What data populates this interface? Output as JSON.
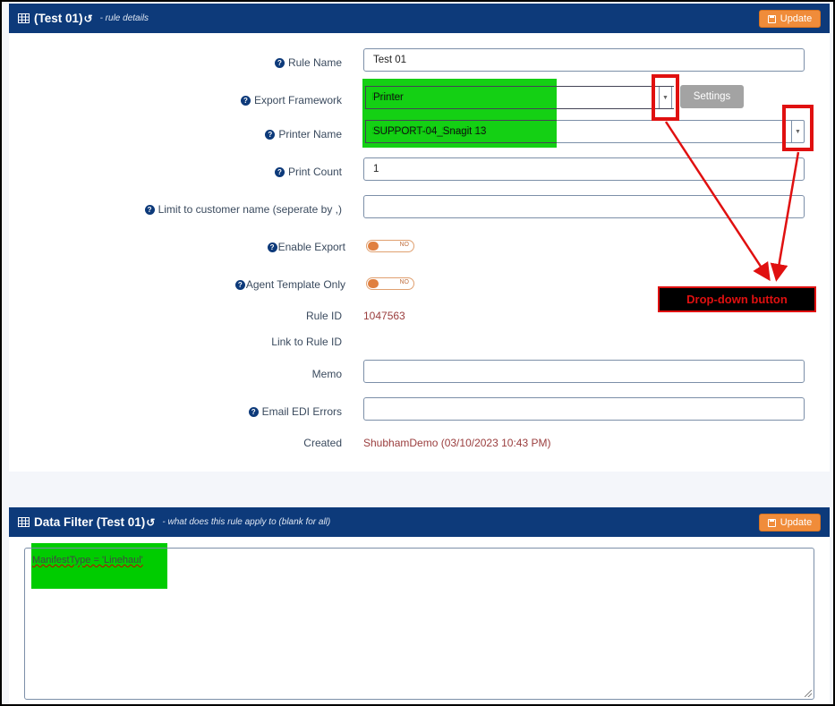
{
  "rule_panel": {
    "title": "(Test 01)",
    "subtitle": "- rule details",
    "update_label": "Update"
  },
  "form": {
    "rule_name": {
      "label": "Rule Name",
      "value": "Test 01"
    },
    "export_framework": {
      "label": "Export Framework",
      "value": "Printer"
    },
    "settings_label": "Settings",
    "printer_name": {
      "label": "Printer Name",
      "value": "SUPPORT-04_Snagit 13"
    },
    "print_count": {
      "label": "Print Count",
      "value": "1"
    },
    "limit_customer": {
      "label": "Limit to customer name (seperate by ,)",
      "value": ""
    },
    "enable_export": {
      "label": "Enable Export",
      "toggle": "NO"
    },
    "agent_template": {
      "label": "Agent Template Only",
      "toggle": "NO"
    },
    "rule_id": {
      "label": "Rule ID",
      "value": "1047563"
    },
    "link_rule_id": {
      "label": "Link to Rule ID",
      "value": ""
    },
    "memo": {
      "label": "Memo",
      "value": ""
    },
    "email_edi": {
      "label": "Email EDI Errors",
      "value": ""
    },
    "created": {
      "label": "Created",
      "value": "ShubhamDemo (03/10/2023 10:43 PM)"
    }
  },
  "annotation": {
    "callout_text": "Drop-down button"
  },
  "filter_panel": {
    "title": "Data Filter (Test 01)",
    "subtitle": "- what does this rule apply to (blank for all)",
    "update_label": "Update",
    "expression": "ManifestType = 'Linehaul'"
  },
  "colors": {
    "header_bg": "#0d3a7a",
    "update_btn": "#f08c3a",
    "highlight": "#00cc00",
    "annotation_red": "#e01010",
    "value_text": "#9a3d3d"
  },
  "icons": [
    "table-icon",
    "undo-icon",
    "save-icon",
    "question-icon",
    "caret-down-icon"
  ]
}
